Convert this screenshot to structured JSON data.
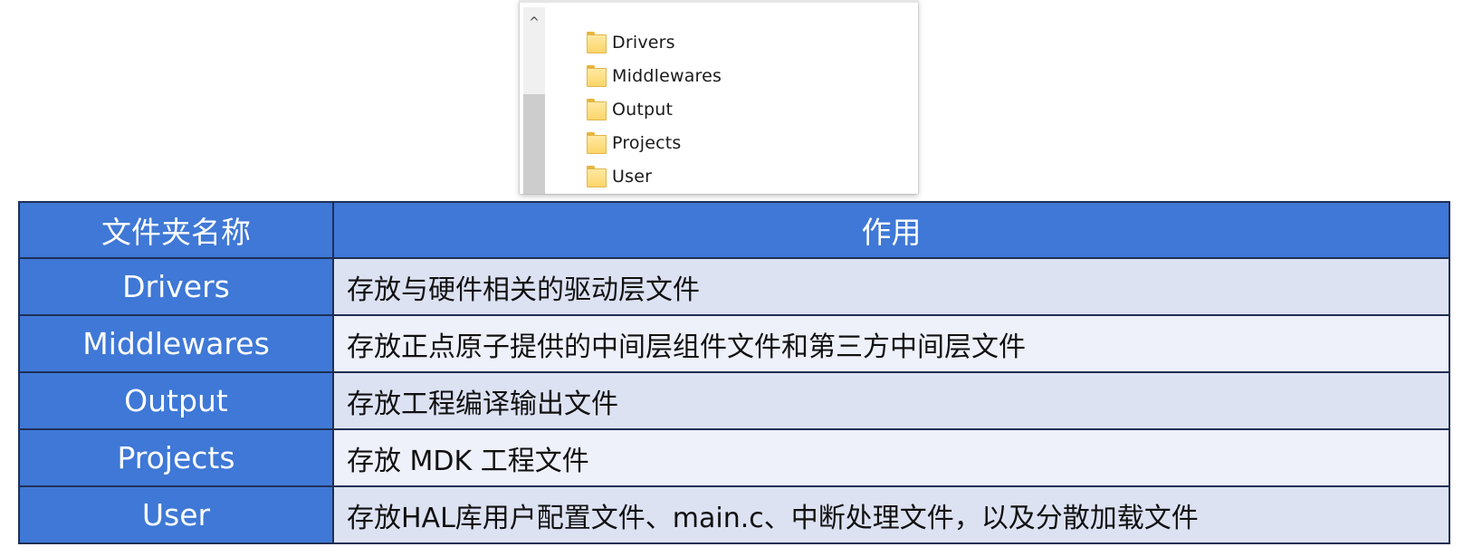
{
  "explorer": {
    "scroll_up_glyph": "^",
    "folders": [
      {
        "name": "Drivers"
      },
      {
        "name": "Middlewares"
      },
      {
        "name": "Output"
      },
      {
        "name": "Projects"
      },
      {
        "name": "User"
      }
    ]
  },
  "table": {
    "headers": [
      "文件夹名称",
      "作用"
    ],
    "rows": [
      {
        "name": "Drivers",
        "desc": "存放与硬件相关的驱动层文件"
      },
      {
        "name": "Middlewares",
        "desc": "存放正点原子提供的中间层组件文件和第三方中间层文件"
      },
      {
        "name": "Output",
        "desc": "存放工程编译输出文件"
      },
      {
        "name": "Projects",
        "desc": "存放 MDK 工程文件"
      },
      {
        "name": "User",
        "desc": "存放HAL库用户配置文件、main.c、中断处理文件，以及分散加载文件"
      }
    ]
  },
  "colors": {
    "header_blue": "#3f78d6",
    "row_light": "#dde2f3",
    "row_lighter": "#eef0fa",
    "border": "#1f2f55",
    "folder_yellow": "#fcd66a"
  },
  "icons": {
    "folder": "folder-icon",
    "scroll_up": "chevron-up-icon"
  }
}
